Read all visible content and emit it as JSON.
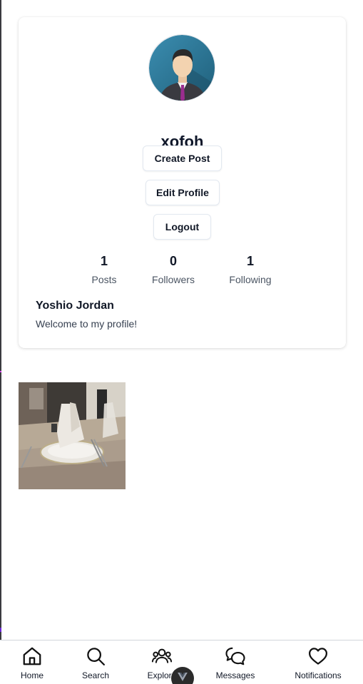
{
  "profile": {
    "username": "xofoh",
    "full_name": "Yoshio Jordan",
    "bio": "Welcome to my profile!",
    "buttons": {
      "create_post": "Create Post",
      "edit_profile": "Edit Profile",
      "logout": "Logout"
    },
    "stats": {
      "posts": {
        "value": "1",
        "label": "Posts"
      },
      "followers": {
        "value": "0",
        "label": "Followers"
      },
      "following": {
        "value": "1",
        "label": "Following"
      }
    }
  },
  "posts": [
    {
      "icon": "dining-table-photo"
    }
  ],
  "nav": {
    "items": [
      {
        "label": "Home",
        "icon": "home-icon"
      },
      {
        "label": "Search",
        "icon": "search-icon"
      },
      {
        "label": "Explore",
        "icon": "users-icon"
      },
      {
        "label": "Messages",
        "icon": "chat-bubbles-icon"
      },
      {
        "label": "Notifications",
        "icon": "heart-icon"
      }
    ]
  },
  "colors": {
    "card_bg": "#ffffff",
    "text": "#111827",
    "muted": "#4b5563",
    "border": "#e2e8f0",
    "avatar_bg": "#2f7a9a"
  }
}
